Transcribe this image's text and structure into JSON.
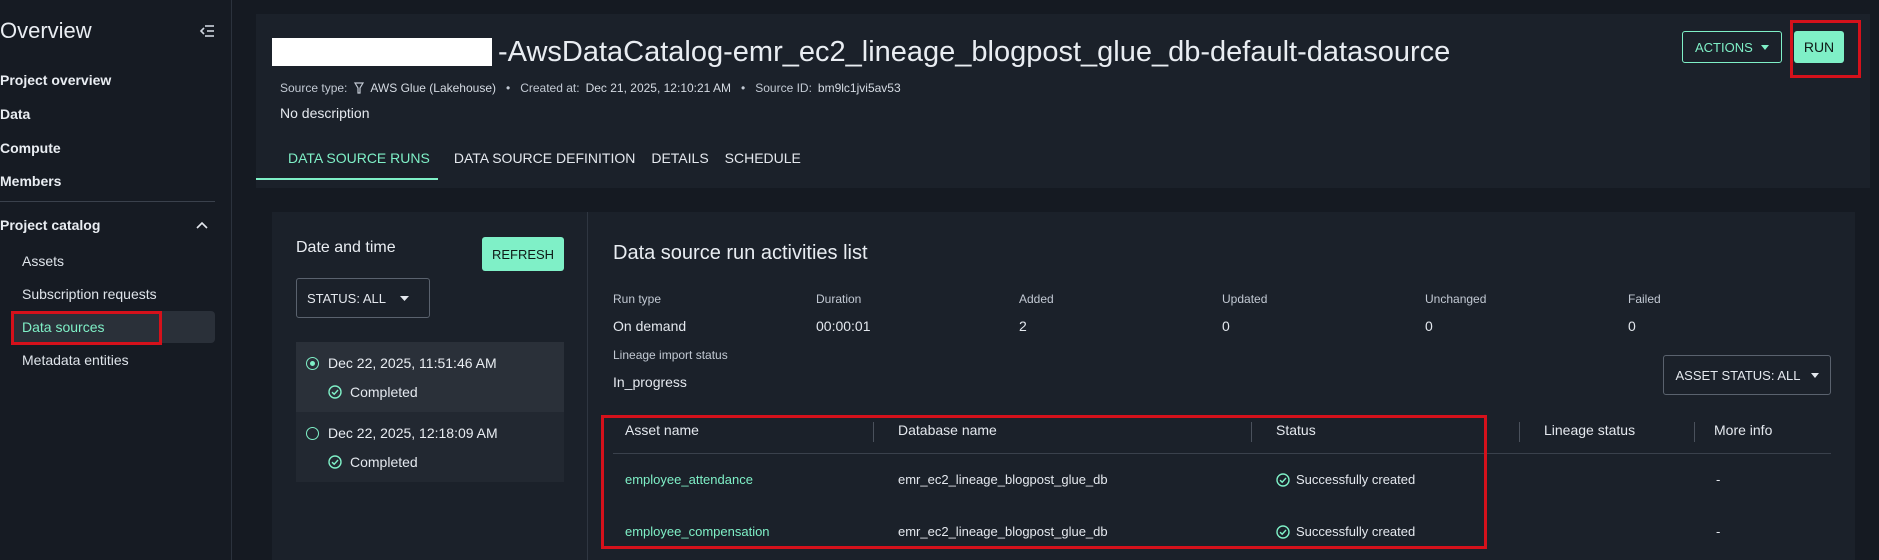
{
  "sidebar": {
    "title": "Overview",
    "nav": [
      "Project overview",
      "Data",
      "Compute",
      "Members"
    ],
    "section": "Project catalog",
    "sub_items": [
      "Assets",
      "Subscription requests",
      "Data sources",
      "Metadata entities"
    ]
  },
  "header": {
    "title": "-AwsDataCatalog-emr_ec2_lineage_blogpost_glue_db-default-datasource",
    "source_type_label": "Source type:",
    "source_type_value": "AWS Glue (Lakehouse)",
    "created_label": "Created at:",
    "created_value": "Dec 21, 2025, 12:10:21 AM",
    "source_id_label": "Source ID:",
    "source_id_value": "bm9lc1jvi5av53",
    "description": "No description",
    "tabs": [
      "DATA SOURCE RUNS",
      "DATA SOURCE DEFINITION",
      "DETAILS",
      "SCHEDULE"
    ],
    "actions_label": "ACTIONS",
    "run_label": "RUN"
  },
  "runs": {
    "title": "Date and time",
    "refresh_label": "REFRESH",
    "status_filter": "STATUS: ALL",
    "items": [
      {
        "date": "Dec 22, 2025, 11:51:46 AM",
        "status": "Completed"
      },
      {
        "date": "Dec 22, 2025, 12:18:09 AM",
        "status": "Completed"
      }
    ]
  },
  "activities": {
    "title": "Data source run activities list",
    "stats": [
      {
        "label": "Run type",
        "value": "On demand"
      },
      {
        "label": "Duration",
        "value": "00:00:01"
      },
      {
        "label": "Added",
        "value": "2"
      },
      {
        "label": "Updated",
        "value": "0"
      },
      {
        "label": "Unchanged",
        "value": "0"
      },
      {
        "label": "Failed",
        "value": "0"
      }
    ],
    "lineage_label": "Lineage import status",
    "lineage_value": "In_progress",
    "asset_status_filter": "ASSET STATUS: ALL",
    "columns": [
      "Asset name",
      "Database name",
      "Status",
      "Lineage status",
      "More info"
    ],
    "rows": [
      {
        "asset": "employee_attendance",
        "database": "emr_ec2_lineage_blogpost_glue_db",
        "status": "Successfully created",
        "lineage": "",
        "more": "-"
      },
      {
        "asset": "employee_compensation",
        "database": "emr_ec2_lineage_blogpost_glue_db",
        "status": "Successfully created",
        "lineage": "",
        "more": "-"
      }
    ]
  },
  "colors": {
    "accent": "#7ff0c7",
    "highlight": "#d5111b",
    "background": "#151a22",
    "panel": "#1b212a"
  },
  "icons": [
    "collapse-menu-icon",
    "chevron-up-icon",
    "glue-icon",
    "caret-down-icon",
    "check-circle-icon",
    "radio-icon"
  ]
}
